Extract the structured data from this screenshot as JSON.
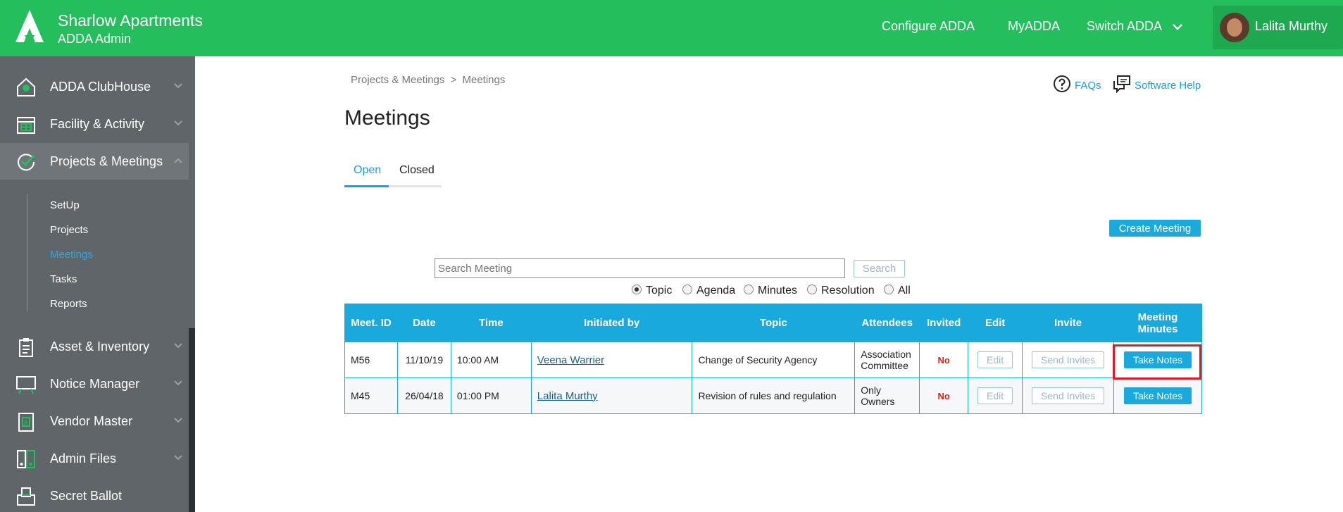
{
  "header": {
    "title": "Sharlow Apartments",
    "subtitle": "ADDA Admin",
    "nav": [
      "Configure ADDA",
      "MyADDA",
      "Switch ADDA"
    ],
    "user": "Lalita Murthy",
    "brand_color": "#25be5c"
  },
  "sidebar": {
    "items": [
      {
        "label": "ADDA ClubHouse",
        "icon": "clubhouse-icon"
      },
      {
        "label": "Facility & Activity",
        "icon": "calendar-icon"
      },
      {
        "label": "Projects & Meetings",
        "icon": "check-circle-icon"
      },
      {
        "label": "Asset & Inventory",
        "icon": "clipboard-icon"
      },
      {
        "label": "Notice Manager",
        "icon": "notice-board-icon"
      },
      {
        "label": "Vendor Master",
        "icon": "vendor-icon"
      },
      {
        "label": "Admin Files",
        "icon": "files-icon"
      },
      {
        "label": "Secret Ballot",
        "icon": "ballot-box-icon"
      }
    ],
    "subitems": [
      "SetUp",
      "Projects",
      "Meetings",
      "Tasks",
      "Reports"
    ],
    "current_subitem": "Meetings"
  },
  "breadcrumb": {
    "parent": "Projects & Meetings",
    "separator": ">",
    "current": "Meetings"
  },
  "help": {
    "faqs": "FAQs",
    "software_help": "Software Help"
  },
  "page": {
    "title": "Meetings"
  },
  "tabs": {
    "open": "Open",
    "closed": "Closed"
  },
  "actions": {
    "create_meeting": "Create Meeting"
  },
  "search": {
    "placeholder": "Search Meeting",
    "button": "Search"
  },
  "filters": {
    "options": [
      "Topic",
      "Agenda",
      "Minutes",
      "Resolution",
      "All"
    ],
    "selected": "Topic"
  },
  "table": {
    "columns": [
      "Meet. ID",
      "Date",
      "Time",
      "Initiated by",
      "Topic",
      "Attendees",
      "Invited",
      "Edit",
      "Invite",
      "Meeting Minutes"
    ],
    "rows": [
      {
        "id": "M56",
        "date": "11/10/19",
        "time": "10:00 AM",
        "initiated_by": "Veena Warrier",
        "topic": "Change of Security Agency",
        "attendees": "Association Committee",
        "invited": "No",
        "edit": "Edit",
        "invite": "Send Invites",
        "minutes": "Take Notes"
      },
      {
        "id": "M45",
        "date": "26/04/18",
        "time": "01:00 PM",
        "initiated_by": "Lalita Murthy",
        "topic": "Revision of rules and regulation",
        "attendees": "Only Owners",
        "invited": "No",
        "edit": "Edit",
        "invite": "Send Invites",
        "minutes": "Take Notes"
      }
    ]
  }
}
